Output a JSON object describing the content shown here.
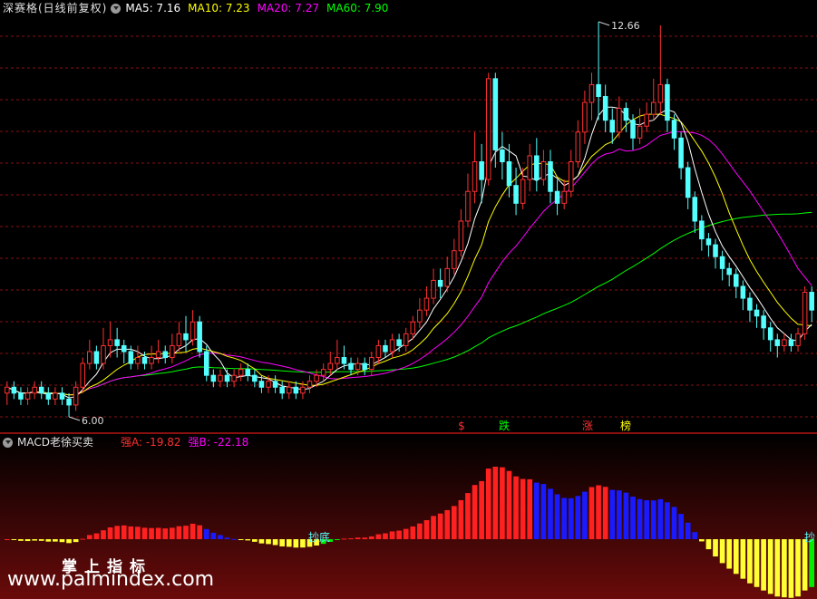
{
  "header": {
    "title": "深赛格(日线前复权)",
    "ma5": "MA5: 7.16",
    "ma10": "MA10: 7.23",
    "ma20": "MA20: 7.27",
    "ma60": "MA60: 7.90"
  },
  "price_labels": {
    "high": "12.66",
    "low": "6.00"
  },
  "signals": [
    {
      "text": "$",
      "color": "#ff3030"
    },
    {
      "text": "跌",
      "color": "#00ff00"
    },
    {
      "text": "涨",
      "color": "#ff3030"
    },
    {
      "text": "榜",
      "color": "#ffff00"
    }
  ],
  "indicator": {
    "title": "MACD老徐买卖",
    "a_label": "强A: -19.82",
    "b_label": "强B: -22.18",
    "annotations": [
      "抄底",
      "抄"
    ]
  },
  "watermark": {
    "line1": "掌上指标",
    "line2": "www.palmindex.com"
  },
  "colors": {
    "up": "#ff3030",
    "down": "#54ffff",
    "ma5": "#ffffff",
    "ma10": "#ffff00",
    "ma20": "#ff00ff",
    "ma60": "#00ff00",
    "grid": "#8a1010",
    "hist_red": "#ff2020",
    "hist_blue": "#1a1aff",
    "hist_yellow": "#ffff33",
    "hist_green": "#00ee00"
  },
  "chart_data": {
    "type": "candlestick",
    "price_range": [
      6.0,
      12.66
    ],
    "candles_approx": [
      [
        6.4,
        6.5,
        6.2,
        6.6
      ],
      [
        6.5,
        6.4,
        6.3,
        6.6
      ],
      [
        6.4,
        6.3,
        6.2,
        6.5
      ],
      [
        6.3,
        6.4,
        6.2,
        6.5
      ],
      [
        6.4,
        6.5,
        6.3,
        6.6
      ],
      [
        6.5,
        6.4,
        6.3,
        6.6
      ],
      [
        6.4,
        6.3,
        6.2,
        6.5
      ],
      [
        6.3,
        6.4,
        6.2,
        6.5
      ],
      [
        6.4,
        6.3,
        6.2,
        6.5
      ],
      [
        6.3,
        6.2,
        6.0,
        6.4
      ],
      [
        6.2,
        6.5,
        6.1,
        6.6
      ],
      [
        6.5,
        6.9,
        6.4,
        7.0
      ],
      [
        6.9,
        7.1,
        6.8,
        7.3
      ],
      [
        7.1,
        6.9,
        6.8,
        7.2
      ],
      [
        6.9,
        7.2,
        6.8,
        7.5
      ],
      [
        7.2,
        7.3,
        7.0,
        7.6
      ],
      [
        7.3,
        7.2,
        7.0,
        7.5
      ],
      [
        7.2,
        7.1,
        6.9,
        7.3
      ],
      [
        7.1,
        6.9,
        6.8,
        7.2
      ],
      [
        6.9,
        7.0,
        6.8,
        7.2
      ],
      [
        7.0,
        6.9,
        6.8,
        7.1
      ],
      [
        6.9,
        7.0,
        6.8,
        7.2
      ],
      [
        7.0,
        7.1,
        6.9,
        7.3
      ],
      [
        7.1,
        7.0,
        6.9,
        7.2
      ],
      [
        7.0,
        7.2,
        6.9,
        7.4
      ],
      [
        7.2,
        7.4,
        7.1,
        7.6
      ],
      [
        7.4,
        7.3,
        7.1,
        7.7
      ],
      [
        7.3,
        7.6,
        7.2,
        7.8
      ],
      [
        7.6,
        7.1,
        7.0,
        7.7
      ],
      [
        7.1,
        6.7,
        6.6,
        7.2
      ],
      [
        6.7,
        6.6,
        6.5,
        6.8
      ],
      [
        6.6,
        6.7,
        6.5,
        6.8
      ],
      [
        6.7,
        6.6,
        6.5,
        6.8
      ],
      [
        6.6,
        6.7,
        6.5,
        6.8
      ],
      [
        6.7,
        6.8,
        6.6,
        6.9
      ],
      [
        6.8,
        6.7,
        6.6,
        6.9
      ],
      [
        6.7,
        6.6,
        6.5,
        6.8
      ],
      [
        6.6,
        6.5,
        6.4,
        6.7
      ],
      [
        6.5,
        6.6,
        6.4,
        6.7
      ],
      [
        6.6,
        6.5,
        6.4,
        6.7
      ],
      [
        6.5,
        6.4,
        6.3,
        6.6
      ],
      [
        6.4,
        6.5,
        6.3,
        6.6
      ],
      [
        6.5,
        6.4,
        6.3,
        6.6
      ],
      [
        6.4,
        6.5,
        6.3,
        6.6
      ],
      [
        6.5,
        6.6,
        6.4,
        6.7
      ],
      [
        6.6,
        6.7,
        6.5,
        6.8
      ],
      [
        6.7,
        6.8,
        6.6,
        6.9
      ],
      [
        6.8,
        6.9,
        6.7,
        7.1
      ],
      [
        6.9,
        7.0,
        6.8,
        7.3
      ],
      [
        7.0,
        6.9,
        6.8,
        7.2
      ],
      [
        6.9,
        6.8,
        6.7,
        7.0
      ],
      [
        6.8,
        6.9,
        6.7,
        7.0
      ],
      [
        6.9,
        6.8,
        6.7,
        7.0
      ],
      [
        6.8,
        7.0,
        6.7,
        7.1
      ],
      [
        7.0,
        7.2,
        6.9,
        7.3
      ],
      [
        7.2,
        7.1,
        7.0,
        7.3
      ],
      [
        7.1,
        7.3,
        7.0,
        7.4
      ],
      [
        7.3,
        7.2,
        7.1,
        7.4
      ],
      [
        7.2,
        7.4,
        7.1,
        7.5
      ],
      [
        7.4,
        7.6,
        7.3,
        7.7
      ],
      [
        7.6,
        7.8,
        7.5,
        8.0
      ],
      [
        7.8,
        8.0,
        7.7,
        8.2
      ],
      [
        8.0,
        8.3,
        7.9,
        8.5
      ],
      [
        8.3,
        8.2,
        8.0,
        8.5
      ],
      [
        8.2,
        8.5,
        8.1,
        8.7
      ],
      [
        8.5,
        8.8,
        8.4,
        9.0
      ],
      [
        8.8,
        9.3,
        8.7,
        9.5
      ],
      [
        9.3,
        9.8,
        9.2,
        10.1
      ],
      [
        9.8,
        10.3,
        9.6,
        10.8
      ],
      [
        10.3,
        10.0,
        9.6,
        10.6
      ],
      [
        10.0,
        11.7,
        9.9,
        11.8
      ],
      [
        11.7,
        10.5,
        10.2,
        11.8
      ],
      [
        10.5,
        10.3,
        10.0,
        10.8
      ],
      [
        10.3,
        9.9,
        9.7,
        10.6
      ],
      [
        9.9,
        9.6,
        9.4,
        10.2
      ],
      [
        9.6,
        10.0,
        9.5,
        10.2
      ],
      [
        10.0,
        10.4,
        9.8,
        10.6
      ],
      [
        10.4,
        10.0,
        9.8,
        10.7
      ],
      [
        10.0,
        10.3,
        9.9,
        10.5
      ],
      [
        10.3,
        9.8,
        9.6,
        10.5
      ],
      [
        9.8,
        9.6,
        9.4,
        10.0
      ],
      [
        9.6,
        9.8,
        9.5,
        10.0
      ],
      [
        9.8,
        10.3,
        9.7,
        10.5
      ],
      [
        10.3,
        10.8,
        10.2,
        11.0
      ],
      [
        10.8,
        11.3,
        10.6,
        11.5
      ],
      [
        11.3,
        11.6,
        11.0,
        11.8
      ],
      [
        11.6,
        11.4,
        11.0,
        12.66
      ],
      [
        11.4,
        11.0,
        10.8,
        11.6
      ],
      [
        11.0,
        10.8,
        10.6,
        11.2
      ],
      [
        10.8,
        11.2,
        10.7,
        11.4
      ],
      [
        11.2,
        11.0,
        10.8,
        11.3
      ],
      [
        11.0,
        10.7,
        10.5,
        11.1
      ],
      [
        10.7,
        10.9,
        10.6,
        11.2
      ],
      [
        10.9,
        11.1,
        10.8,
        11.3
      ],
      [
        11.1,
        11.3,
        11.0,
        11.7
      ],
      [
        11.3,
        11.6,
        11.1,
        12.6
      ],
      [
        11.6,
        11.0,
        10.8,
        11.7
      ],
      [
        11.0,
        10.7,
        10.5,
        11.1
      ],
      [
        10.7,
        10.2,
        10.0,
        10.8
      ],
      [
        10.2,
        9.7,
        9.5,
        10.3
      ],
      [
        9.7,
        9.3,
        9.1,
        9.8
      ],
      [
        9.3,
        9.0,
        8.8,
        9.4
      ],
      [
        9.0,
        8.9,
        8.7,
        9.1
      ],
      [
        8.9,
        8.7,
        8.5,
        9.0
      ],
      [
        8.7,
        8.5,
        8.3,
        8.8
      ],
      [
        8.5,
        8.4,
        8.2,
        8.6
      ],
      [
        8.4,
        8.2,
        8.0,
        8.5
      ],
      [
        8.2,
        8.0,
        7.8,
        8.3
      ],
      [
        8.0,
        7.8,
        7.6,
        8.1
      ],
      [
        7.8,
        7.7,
        7.5,
        7.9
      ],
      [
        7.7,
        7.5,
        7.3,
        7.8
      ],
      [
        7.5,
        7.3,
        7.1,
        7.6
      ],
      [
        7.3,
        7.2,
        7.0,
        7.4
      ],
      [
        7.2,
        7.3,
        7.1,
        7.4
      ],
      [
        7.3,
        7.2,
        7.1,
        7.4
      ],
      [
        7.2,
        7.4,
        7.1,
        7.5
      ],
      [
        7.4,
        8.1,
        7.3,
        8.2
      ],
      [
        8.1,
        7.8,
        7.6,
        8.2
      ]
    ]
  }
}
